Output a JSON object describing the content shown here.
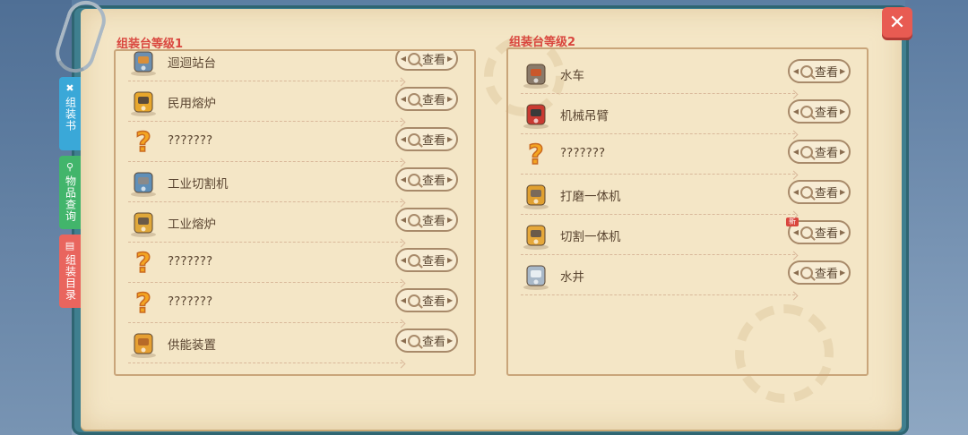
{
  "panels": [
    {
      "title": "组装台等级1",
      "items": [
        {
          "name": "迴迴站台",
          "icon": "station-icon",
          "new": false
        },
        {
          "name": "民用熔炉",
          "icon": "furnace-icon",
          "new": false
        },
        {
          "name": "???????",
          "icon": "question-icon",
          "new": false
        },
        {
          "name": "工业切割机",
          "icon": "cutter-icon",
          "new": false
        },
        {
          "name": "工业熔炉",
          "icon": "industrial-furnace-icon",
          "new": false
        },
        {
          "name": "???????",
          "icon": "question-icon",
          "new": false
        },
        {
          "name": "???????",
          "icon": "question-icon",
          "new": false
        },
        {
          "name": "供能装置",
          "icon": "power-device-icon",
          "new": false
        }
      ]
    },
    {
      "title": "组装台等级2",
      "items": [
        {
          "name": "水车",
          "icon": "waterwheel-icon",
          "new": false
        },
        {
          "name": "机械吊臂",
          "icon": "crane-icon",
          "new": false
        },
        {
          "name": "???????",
          "icon": "question-icon",
          "new": false
        },
        {
          "name": "打磨一体机",
          "icon": "grinder-icon",
          "new": false
        },
        {
          "name": "切割一体机",
          "icon": "cutting-machine-icon",
          "new": true
        },
        {
          "name": "水井",
          "icon": "well-icon",
          "new": false
        }
      ]
    }
  ],
  "view_label": "查看",
  "new_label": "新",
  "close_label": "✕",
  "side_tabs": [
    {
      "label": "组装书",
      "icon": "tools-icon",
      "color": "#3aa8d8"
    },
    {
      "label": "物品查询",
      "icon": "search-icon",
      "color": "#42b56b"
    },
    {
      "label": "组装目录",
      "icon": "catalog-icon",
      "color": "#e9655e"
    }
  ]
}
